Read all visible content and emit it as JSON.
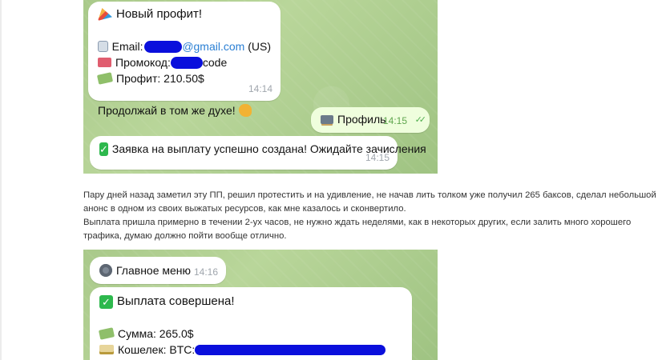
{
  "shot1": {
    "profit_msg": {
      "title": "Новый профит!",
      "email_label": "Email:",
      "email_suffix": "@gmail.com",
      "email_country": "(US)",
      "promo_label": "Промокод:",
      "promo_suffix": "code",
      "profit_line": "Профит: 210.50$",
      "cheer": "Продолжай в том же духе!",
      "time": "14:14"
    },
    "profile_msg": {
      "text": "Профиль",
      "time": "14:15",
      "ticks": "✓✓"
    },
    "withdraw_msg": {
      "text": "Заявка на выплату успешно создана! Ожидайте зачисления",
      "time": "14:15"
    }
  },
  "post": {
    "paragraph1": "Пару дней назад заметил эту ПП, решил протестить и на удивление, не начав лить толком уже получил 265 баксов, сделал небольшой анонс в одном из своих выжатых ресурсов, как мне казалось и сконвертило.",
    "paragraph2": "Выплата пришла примерно в течении 2-ух часов, не нужно ждать неделями, как в некоторых других, если залить много хорошего трафика, думаю должно пойти вообще отлично."
  },
  "shot2": {
    "menu_msg": {
      "text": "Главное меню",
      "time": "14:16"
    },
    "payout_msg": {
      "title": "Выплата совершена!",
      "amount_line": "Сумма: 265.0$",
      "wallet_label": "Кошелек: BTC:"
    }
  }
}
